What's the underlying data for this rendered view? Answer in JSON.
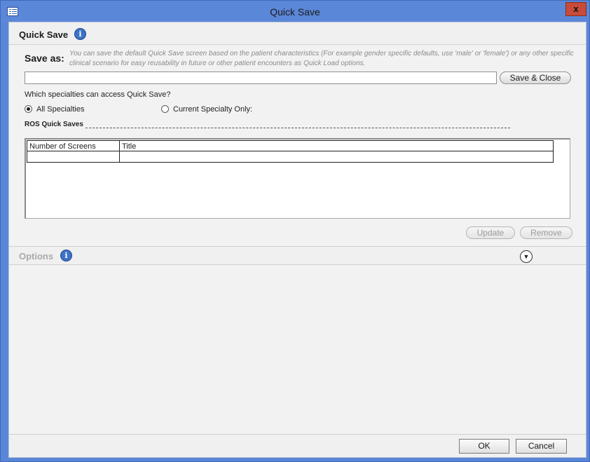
{
  "window": {
    "title": "Quick Save",
    "close_glyph": "x"
  },
  "quick_save": {
    "header": "Quick Save",
    "info_glyph": "i",
    "save_as_label": "Save as:",
    "hint": "You can save the default Quick Save screen based on the patient characteristics (For example gender specific defaults, use 'male' or 'female') or any other specific clinical scenario for easy reusability in future or other patient encounters as Quick Load options.",
    "name_value": "",
    "save_close_label": "Save & Close",
    "specialties_question": "Which specialties can access Quick Save?",
    "radio_all": "All Specialties",
    "radio_current": "Current Specialty Only:",
    "selected_radio": "All Specialties"
  },
  "ros": {
    "label": "ROS Quick Saves",
    "columns": [
      "Number of Screens",
      "Title"
    ],
    "rows": [
      [
        "",
        ""
      ]
    ],
    "update_label": "Update",
    "remove_label": "Remove"
  },
  "options": {
    "header": "Options",
    "info_glyph": "i",
    "collapse_glyph": "▼"
  },
  "footer": {
    "ok_label": "OK",
    "cancel_label": "Cancel"
  },
  "colors": {
    "titlebar": "#5b87d9",
    "close": "#c74b3a",
    "info_icon": "#3d72c7"
  },
  "icons": {
    "app": "window-list-icon",
    "close": "close-icon",
    "info": "info-icon",
    "collapse": "chevron-down-circle-icon"
  }
}
